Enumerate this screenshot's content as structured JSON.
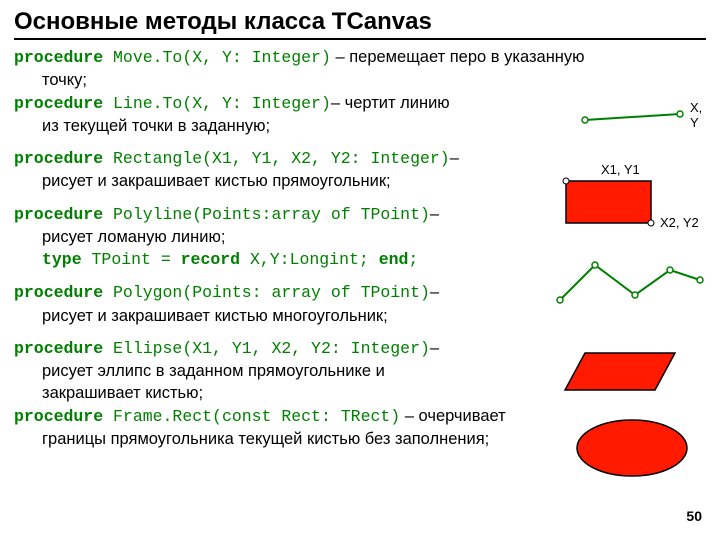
{
  "title": "Основные методы класса TCanvas",
  "pagenum": "50",
  "labels": {
    "xy": "X,\nY",
    "x1y1": "X1, Y1",
    "x2y2": "X2, Y2"
  },
  "items": [
    {
      "kw0": "procedure",
      "code0": " Move.To(X, Y: Integer)",
      "text0": " – перемещает перо в указанную",
      "indent0": "точку;"
    },
    {
      "kw0": "procedure",
      "code0": " Line.To(X, Y: Integer)",
      "text0": "– чертит линию",
      "indent0": "из текущей точки в заданную;"
    },
    {
      "kw0": "procedure",
      "code0": " Rectangle(X1, Y1, X2, Y2: Integer)",
      "text0": "–",
      "indent0": "рисует и закрашивает кистью прямоугольник;"
    },
    {
      "kw0": "procedure",
      "code0": " Polyline(Points:array of TPoint)",
      "text0": "–",
      "indent0": "рисует ломаную линию;",
      "kw1": "type",
      "code1": " TPoint = ",
      "kw2": "record",
      "code2": "  X,Y:Longint; ",
      "kw3": "end",
      "code3": ";"
    },
    {
      "kw0": "procedure",
      "code0": " Polygon(Points: array of TPoint)",
      "text0": "–",
      "indent0": "рисует и закрашивает кистью многоугольник;"
    },
    {
      "kw0": "procedure",
      "code0": " Ellipse(X1, Y1, X2, Y2: Integer)",
      "text0": "–",
      "indent0": "рисует эллипс в заданном прямоугольнике и",
      "indent1": "закрашивает кистью;"
    },
    {
      "kw0": "procedure",
      "code0": " Frame.Rect(const Rect: TRect)",
      "text0": " – очерчивает",
      "indent0": "границы прямоугольника текущей кистью без заполнения;"
    }
  ]
}
